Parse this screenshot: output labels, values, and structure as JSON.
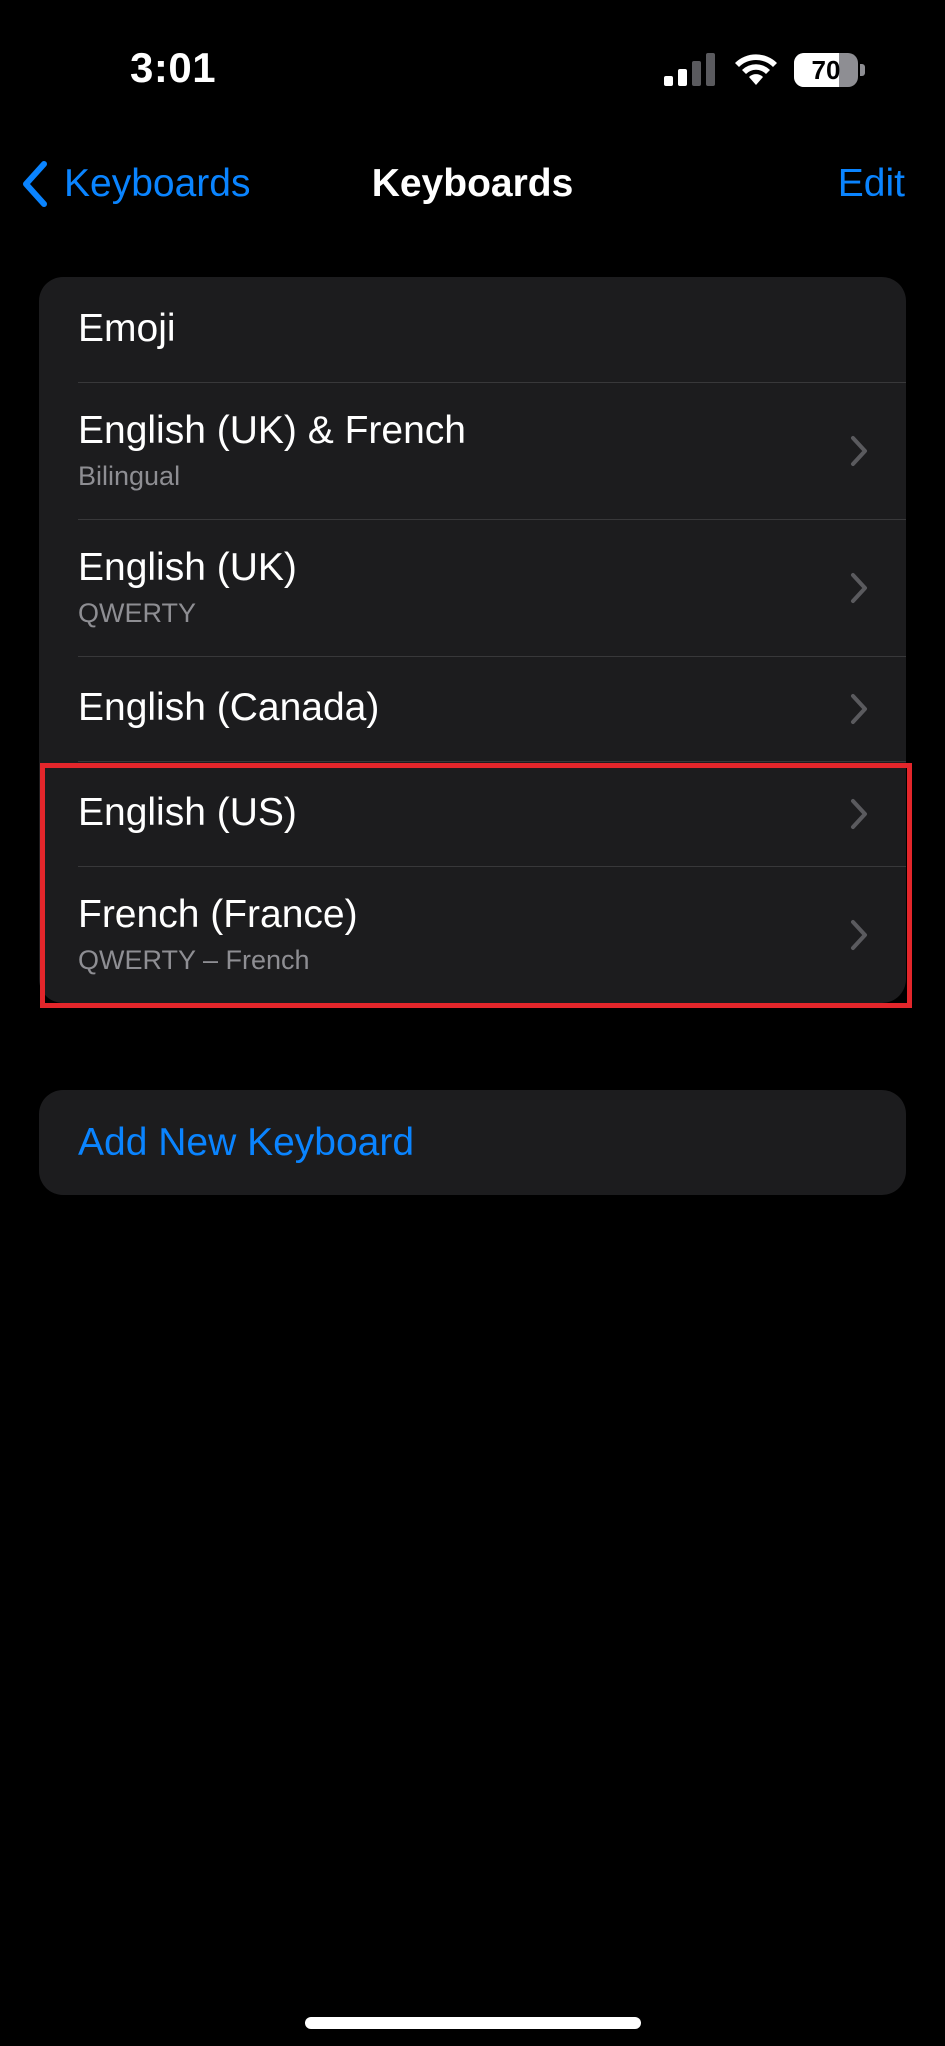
{
  "status_bar": {
    "time": "3:01",
    "battery_text": "70",
    "battery_level": 0.7
  },
  "nav": {
    "back_label": "Keyboards",
    "title": "Keyboards",
    "edit_label": "Edit"
  },
  "keyboards": [
    {
      "title": "Emoji",
      "subtitle": ""
    },
    {
      "title": "English (UK) & French",
      "subtitle": "Bilingual"
    },
    {
      "title": "English (UK)",
      "subtitle": "QWERTY"
    },
    {
      "title": "English (Canada)",
      "subtitle": ""
    },
    {
      "title": "English (US)",
      "subtitle": ""
    },
    {
      "title": "French (France)",
      "subtitle": "QWERTY – French"
    }
  ],
  "add_keyboard_label": "Add New Keyboard",
  "colors": {
    "accent": "#0a84ff",
    "background": "#000000",
    "cell": "#1c1c1e",
    "highlight": "#e3262b"
  },
  "icons": [
    "signal-icon",
    "wifi-icon",
    "battery-icon",
    "chevron-left-icon",
    "chevron-right-icon"
  ]
}
